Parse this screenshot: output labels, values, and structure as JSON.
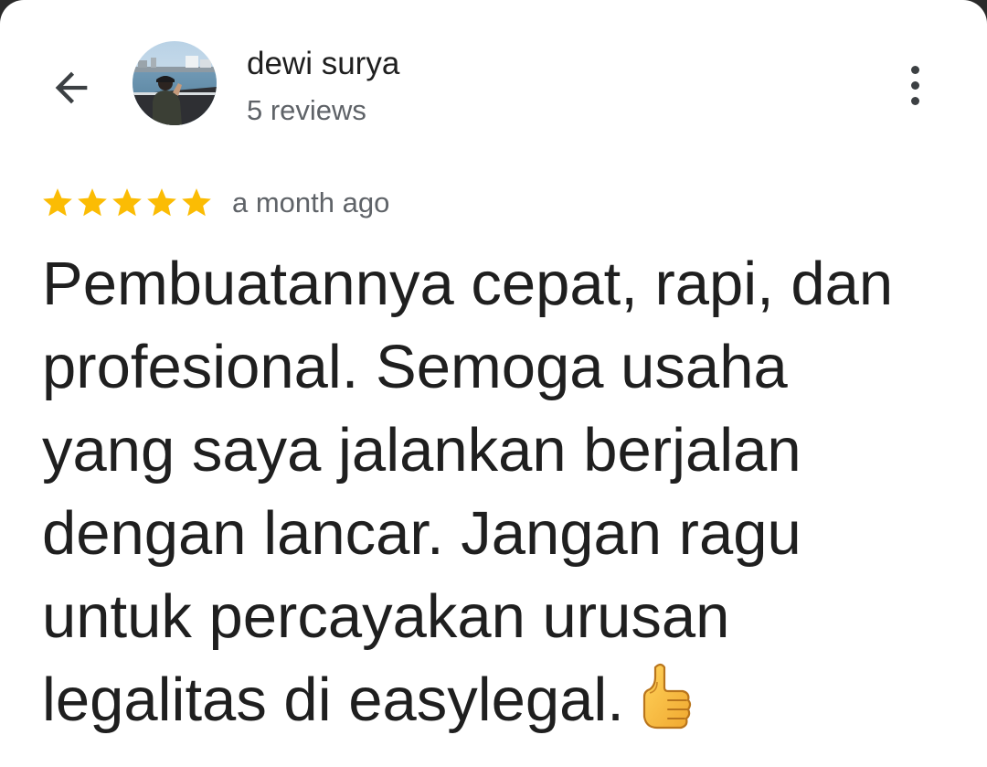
{
  "header": {
    "back_icon": "arrow-back-icon",
    "avatar_icon": "user-avatar-photo",
    "user_name": "dewi surya",
    "review_count": "5 reviews",
    "more_icon": "more-vertical-icon"
  },
  "review": {
    "rating": 5,
    "max_rating": 5,
    "star_color": "#fbbc04",
    "timestamp": "a month ago",
    "lines": [
      "Pembuatannya cepat, rapi, dan",
      "profesional. Semoga usaha",
      "yang saya jalankan berjalan",
      "dengan lancar. Jangan ragu",
      "untuk percayakan urusan",
      "legalitas di easylegal."
    ],
    "trailing_emoji": "thumbs-up-icon"
  }
}
